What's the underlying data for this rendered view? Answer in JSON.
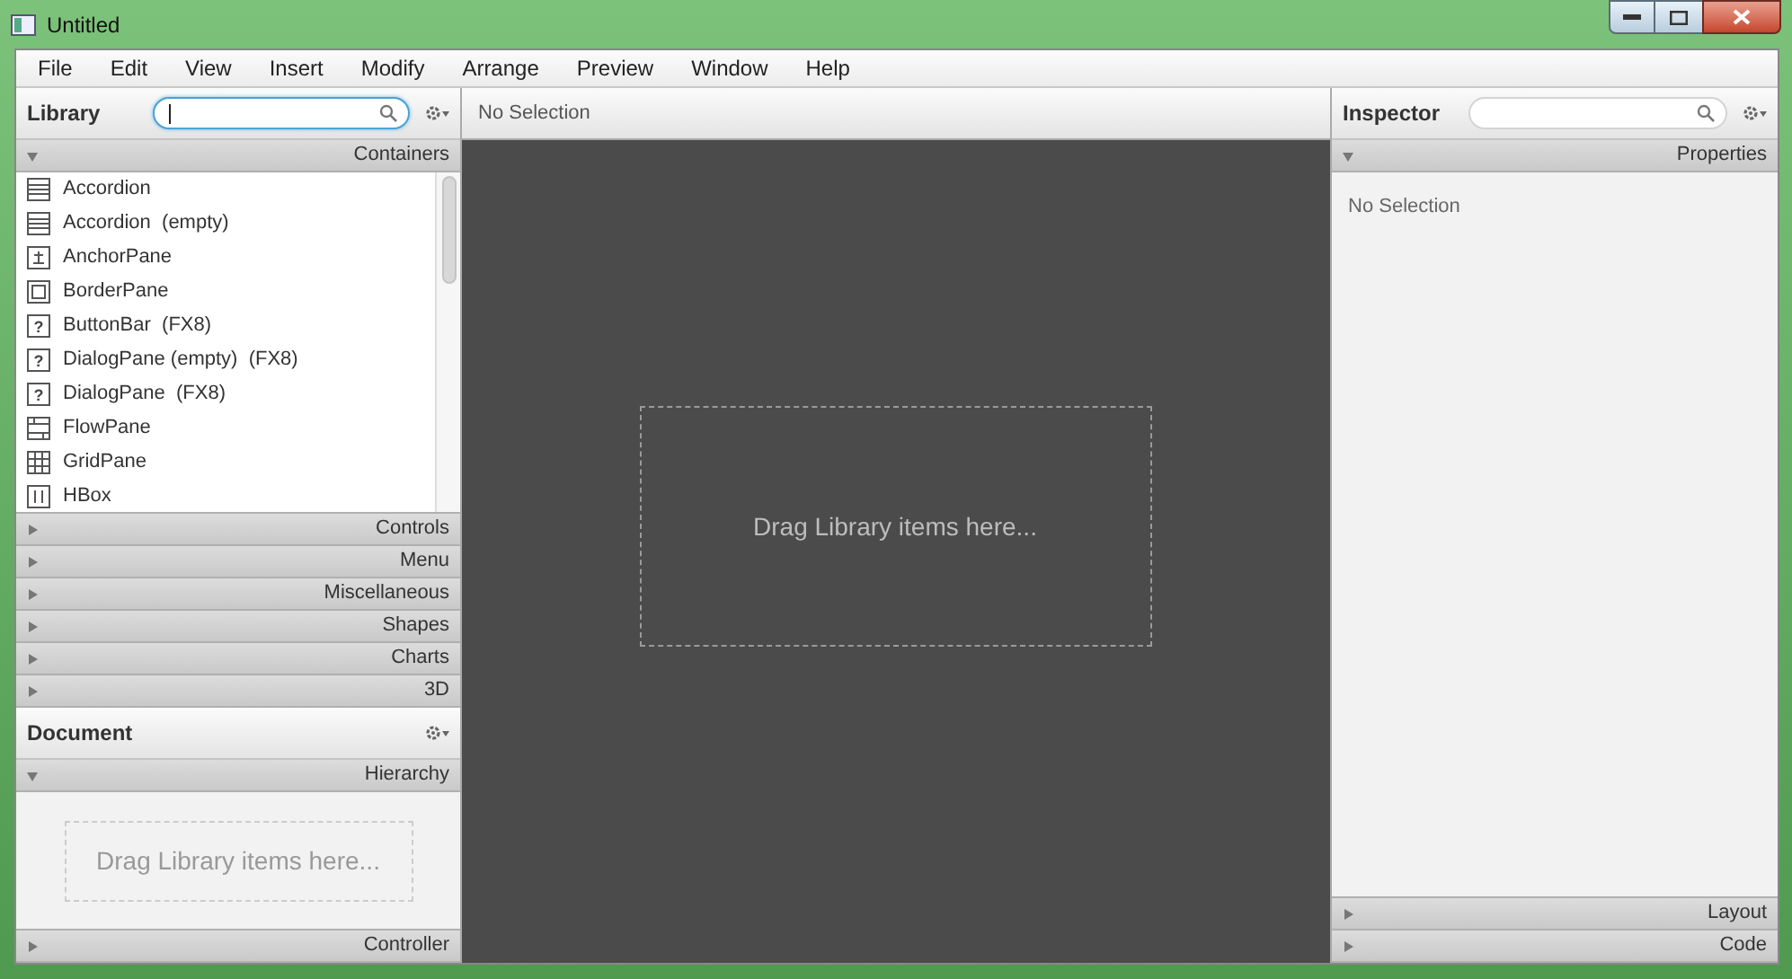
{
  "window": {
    "title": "Untitled"
  },
  "menu": [
    "File",
    "Edit",
    "View",
    "Insert",
    "Modify",
    "Arrange",
    "Preview",
    "Window",
    "Help"
  ],
  "library": {
    "title": "Library",
    "search": {
      "focused": true
    },
    "sections": [
      {
        "label": "Containers",
        "expanded": true,
        "items": [
          {
            "label": "Accordion",
            "kind": "accordion"
          },
          {
            "label": "Accordion  (empty)",
            "kind": "accordion"
          },
          {
            "label": "AnchorPane",
            "kind": "anchor"
          },
          {
            "label": "BorderPane",
            "kind": "border"
          },
          {
            "label": "ButtonBar  (FX8)",
            "kind": "unknown",
            "glyph": "?"
          },
          {
            "label": "DialogPane (empty)  (FX8)",
            "kind": "unknown",
            "glyph": "?"
          },
          {
            "label": "DialogPane  (FX8)",
            "kind": "unknown",
            "glyph": "?"
          },
          {
            "label": "FlowPane",
            "kind": "flow"
          },
          {
            "label": "GridPane",
            "kind": "grid"
          },
          {
            "label": "HBox",
            "kind": "hbox"
          }
        ]
      },
      {
        "label": "Controls",
        "expanded": false
      },
      {
        "label": "Menu",
        "expanded": false
      },
      {
        "label": "Miscellaneous",
        "expanded": false
      },
      {
        "label": "Shapes",
        "expanded": false
      },
      {
        "label": "Charts",
        "expanded": false
      },
      {
        "label": "3D",
        "expanded": false
      }
    ]
  },
  "document": {
    "title": "Document",
    "sections": [
      {
        "label": "Hierarchy",
        "expanded": true,
        "hint": "Drag Library items here..."
      },
      {
        "label": "Controller",
        "expanded": false
      }
    ]
  },
  "content": {
    "header": "No Selection",
    "hint": "Drag Library items here..."
  },
  "inspector": {
    "title": "Inspector",
    "search": {
      "focused": false
    },
    "sections": [
      {
        "label": "Properties",
        "expanded": true,
        "body": "No Selection"
      },
      {
        "label": "Layout",
        "expanded": false
      },
      {
        "label": "Code",
        "expanded": false
      }
    ]
  }
}
